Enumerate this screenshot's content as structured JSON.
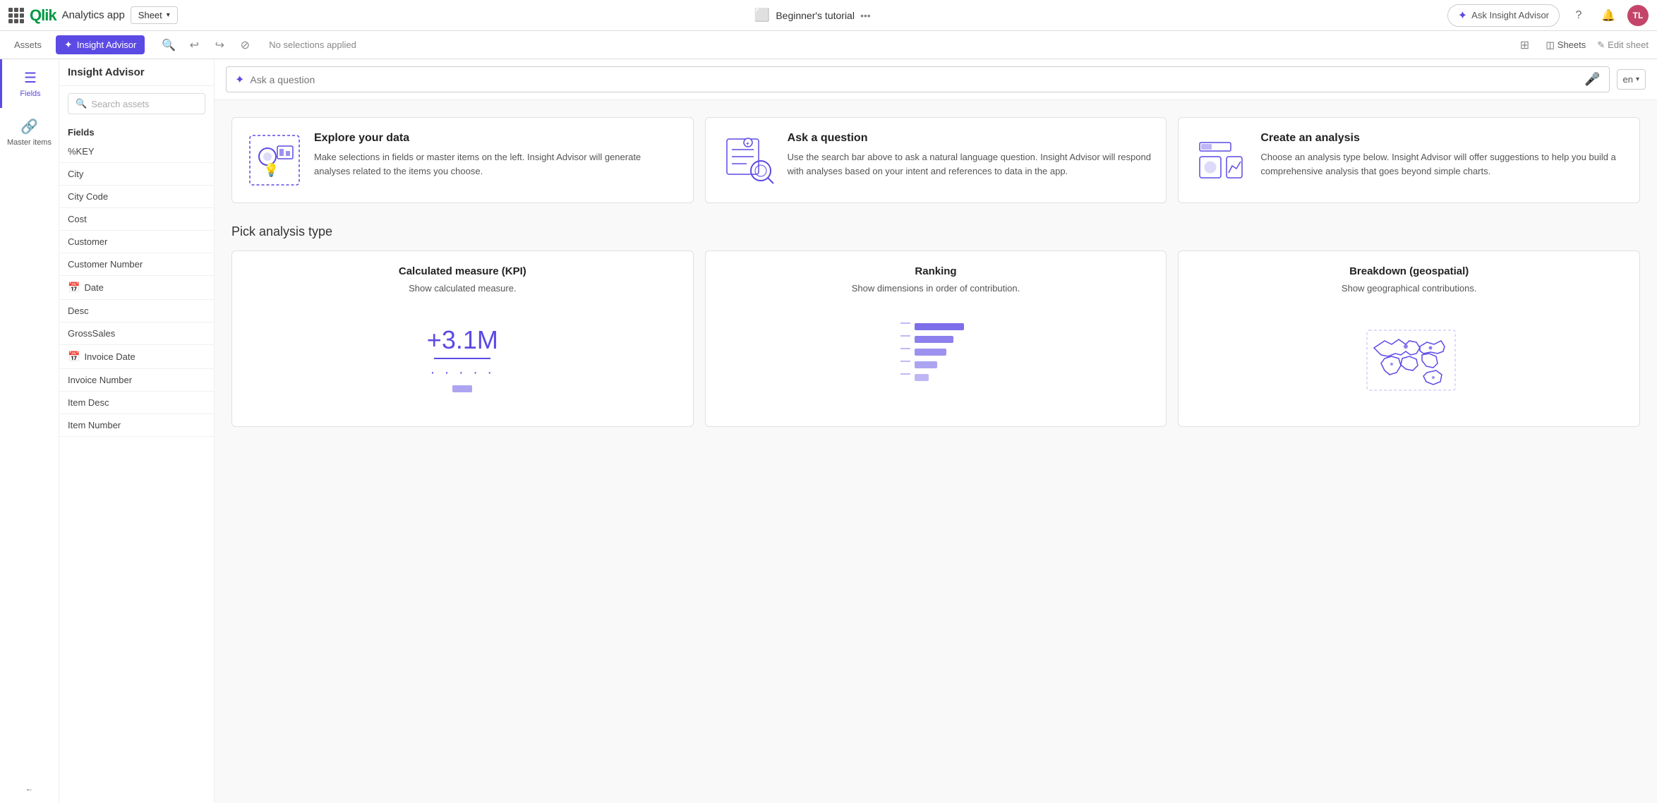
{
  "topBar": {
    "appName": "Analytics app",
    "sheetLabel": "Sheet",
    "tutorialLabel": "Beginner's tutorial",
    "insightAdvisorBtn": "Ask Insight Advisor",
    "avatarInitials": "TL"
  },
  "secondBar": {
    "assetsLabel": "Assets",
    "insightAdvisorLabel": "Insight Advisor",
    "noSelections": "No selections applied",
    "sheetsLabel": "Sheets",
    "editSheetLabel": "Edit sheet"
  },
  "sidebar": {
    "title": "Insight Advisor",
    "searchPlaceholder": "Search assets",
    "sectionLabel": "Fields",
    "leftItems": [
      {
        "label": "Fields",
        "icon": "☰"
      },
      {
        "label": "Master items",
        "icon": "🔗"
      }
    ],
    "items": [
      {
        "label": "%KEY",
        "icon": ""
      },
      {
        "label": "City",
        "icon": ""
      },
      {
        "label": "City Code",
        "icon": ""
      },
      {
        "label": "Cost",
        "icon": ""
      },
      {
        "label": "Customer",
        "icon": ""
      },
      {
        "label": "Customer Number",
        "icon": ""
      },
      {
        "label": "Date",
        "icon": "📅"
      },
      {
        "label": "Desc",
        "icon": ""
      },
      {
        "label": "GrossSales",
        "icon": ""
      },
      {
        "label": "Invoice Date",
        "icon": "📅"
      },
      {
        "label": "Invoice Number",
        "icon": ""
      },
      {
        "label": "Item Desc",
        "icon": ""
      },
      {
        "label": "Item Number",
        "icon": ""
      }
    ]
  },
  "contentBar": {
    "askPlaceholder": "Ask a question",
    "langLabel": "en"
  },
  "infoCards": [
    {
      "title": "Explore your data",
      "description": "Make selections in fields or master items on the left. Insight Advisor will generate analyses related to the items you choose."
    },
    {
      "title": "Ask a question",
      "description": "Use the search bar above to ask a natural language question. Insight Advisor will respond with analyses based on your intent and references to data in the app."
    },
    {
      "title": "Create an analysis",
      "description": "Choose an analysis type below. Insight Advisor will offer suggestions to help you build a comprehensive analysis that goes beyond simple charts."
    }
  ],
  "analysisSection": {
    "title": "Pick analysis type",
    "cards": [
      {
        "title": "Calculated measure (KPI)",
        "description": "Show calculated measure.",
        "kpiValue": "+3.1M"
      },
      {
        "title": "Ranking",
        "description": "Show dimensions in order of contribution."
      },
      {
        "title": "Breakdown (geospatial)",
        "description": "Show geographical contributions."
      }
    ]
  }
}
